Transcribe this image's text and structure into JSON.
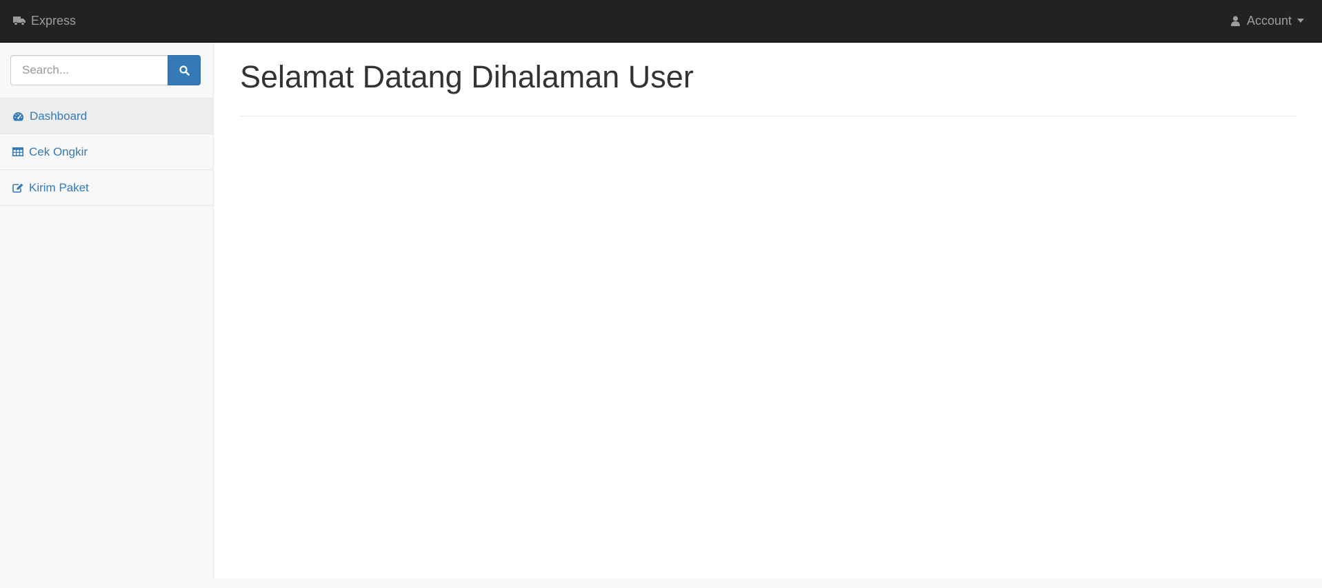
{
  "navbar": {
    "brand": "Express",
    "brand_icon": "truck-icon",
    "account_label": "Account",
    "account_icon": "user-icon"
  },
  "sidebar": {
    "search": {
      "placeholder": "Search...",
      "value": ""
    },
    "items": [
      {
        "label": "Dashboard",
        "icon": "dashboard-icon",
        "active": true
      },
      {
        "label": "Cek Ongkir",
        "icon": "table-icon",
        "active": false
      },
      {
        "label": "Kirim Paket",
        "icon": "edit-icon",
        "active": false
      }
    ]
  },
  "main": {
    "title": "Selamat Datang Dihalaman User"
  },
  "colors": {
    "navbar_bg": "#222222",
    "navbar_text": "#9d9d9d",
    "link": "#337ab7",
    "primary_button": "#337ab7",
    "sidebar_bg": "#f8f8f8",
    "active_item_bg": "#eeeeee",
    "title_text": "#333333"
  }
}
